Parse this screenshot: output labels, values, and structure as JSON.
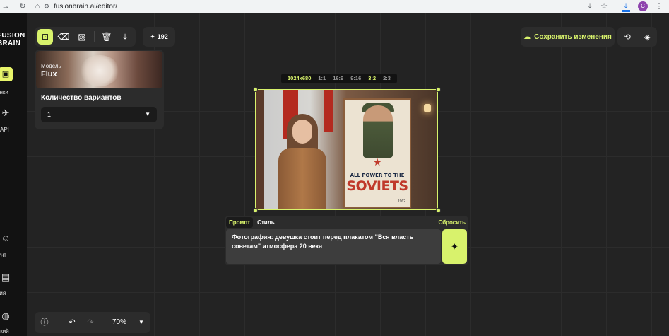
{
  "browser": {
    "url": "fusionbrain.ai/editor/",
    "nav_back": "→",
    "nav_reload": "↻",
    "nav_home": "⌂",
    "site_info_icon": "⚙",
    "install_icon": "⤓",
    "star_icon": "☆",
    "download_icon": "⤓",
    "profile_initial": "C",
    "menu_icon": "⋮"
  },
  "sidebar": {
    "logo_line1": "FUSION",
    "logo_line2": "BRAIN",
    "items": [
      {
        "label": "Картинки",
        "icon": "image-icon"
      },
      {
        "label": "API",
        "icon": "rocket-icon"
      },
      {
        "label": "Аккаунт",
        "icon": "account-icon"
      },
      {
        "label": "Документация",
        "icon": "docs-icon"
      },
      {
        "label": "Русский",
        "icon": "globe-icon"
      }
    ]
  },
  "toolbar": {
    "credits": "192",
    "credits_icon": "✦",
    "save_label": "Сохранить изменения"
  },
  "panel": {
    "model_small": "Модель",
    "model_name": "Flux",
    "variants_label": "Количество вариантов",
    "variants_value": "1"
  },
  "ratios": {
    "size": "1024x680",
    "options": [
      "1:1",
      "16:9",
      "9:16",
      "3:2",
      "2:3"
    ],
    "selected": "3:2"
  },
  "poster": {
    "line1": "ALL POWER TO THE",
    "line2": "SOVIETS",
    "year": "1962"
  },
  "prompt": {
    "tab_prompt": "Промпт",
    "tab_style": "Стиль",
    "reset": "Сбросить",
    "text": "Фотография: девушка стоит перед плакатом \"Вся власть советам\" атмосфера 20 века"
  },
  "bottom": {
    "zoom": "70%"
  },
  "colors": {
    "accent": "#d8f26c",
    "panel": "#2c2c2c",
    "canvas": "#232323"
  }
}
